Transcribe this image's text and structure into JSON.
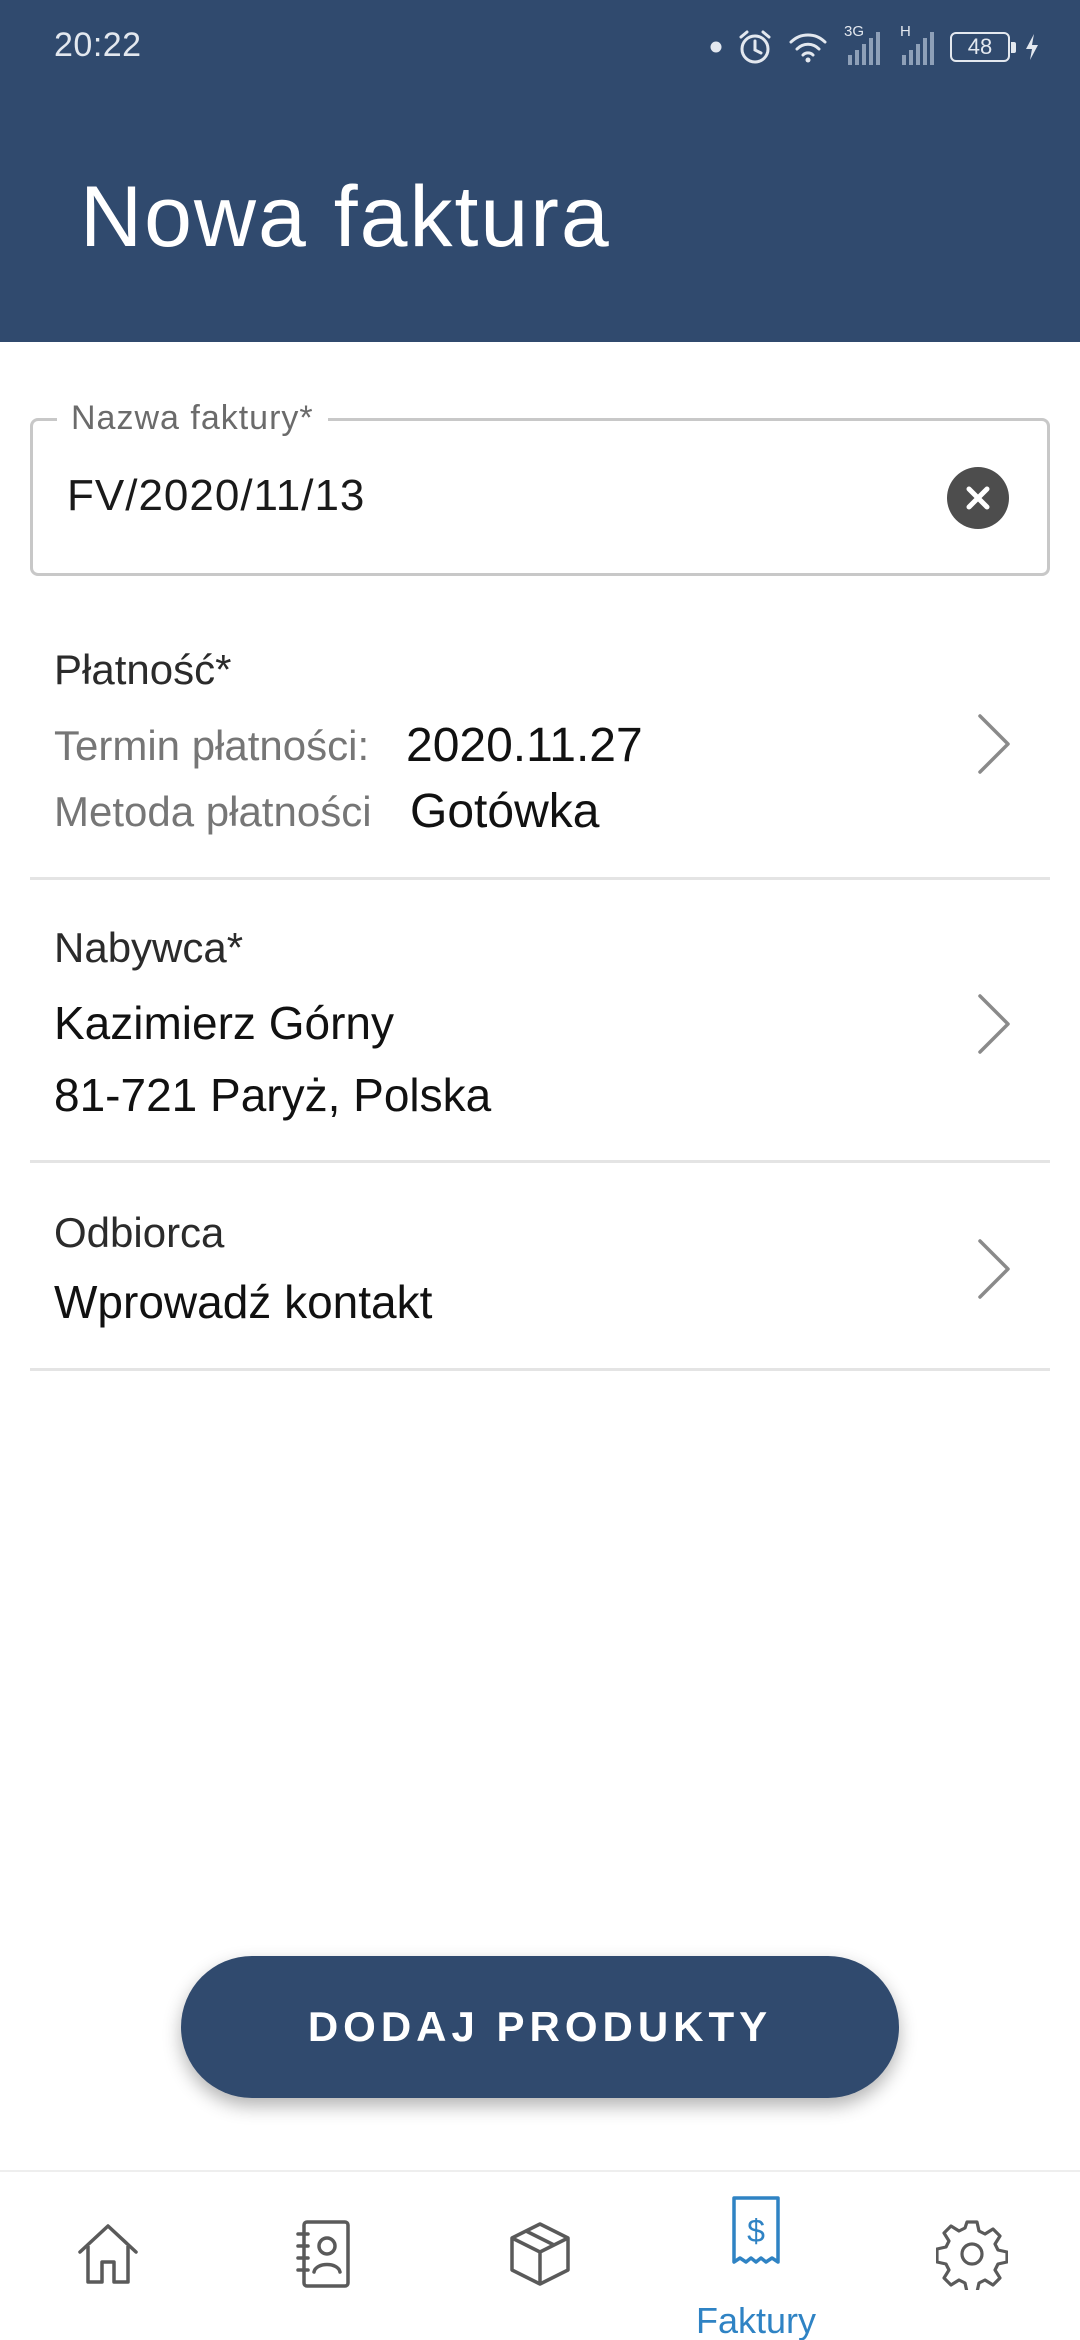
{
  "status_bar": {
    "time": "20:22",
    "network_3g": "3G",
    "network_h": "H",
    "battery_level": "48"
  },
  "header": {
    "title": "Nowa faktura"
  },
  "invoice_name": {
    "label": "Nazwa faktury*",
    "value": "FV/2020/11/13"
  },
  "payment": {
    "label": "Płatność*",
    "due_date_label": "Termin płatności:",
    "due_date_value": "2020.11.27",
    "method_label": "Metoda płatności",
    "method_value": "Gotówka"
  },
  "buyer": {
    "label": "Nabywca*",
    "name": "Kazimierz Górny",
    "address": "81-721 Paryż, Polska"
  },
  "recipient": {
    "label": "Odbiorca",
    "placeholder": "Wprowadź kontakt"
  },
  "actions": {
    "add_products": "DODAJ PRODUKTY"
  },
  "bottom_nav": {
    "active_color": "#2f83c4",
    "inactive_color": "#5a5a5a",
    "items": [
      {
        "icon": "home-icon",
        "label": ""
      },
      {
        "icon": "contacts-icon",
        "label": ""
      },
      {
        "icon": "box-icon",
        "label": ""
      },
      {
        "icon": "invoice-icon",
        "label": "Faktury",
        "active": true
      },
      {
        "icon": "gear-icon",
        "label": ""
      }
    ]
  },
  "colors": {
    "primary": "#304a6e",
    "divider": "#e4e4e4"
  }
}
